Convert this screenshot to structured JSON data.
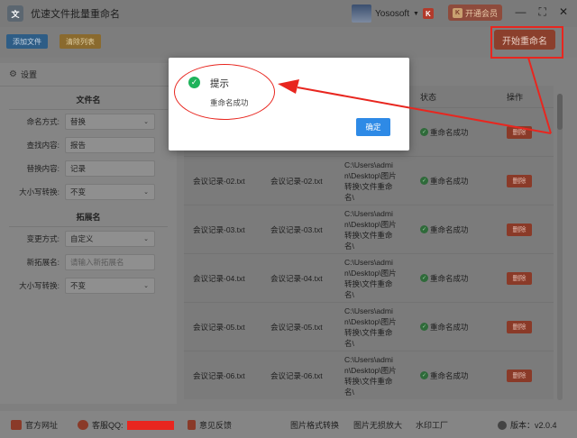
{
  "app": {
    "title": "优速文件批量重命名",
    "user_name": "Yososoft",
    "vip_label": "开通会员",
    "logo_text": "文"
  },
  "toolbar": {
    "add_files": "添加文件",
    "clear_list": "清除列表",
    "start_rename": "开始重命名"
  },
  "settings": {
    "header": "设置",
    "filename_section": "文件名",
    "rename_mode_label": "命名方式:",
    "rename_mode_value": "替换",
    "find_label": "查找内容:",
    "find_value": "报告",
    "replace_label": "替换内容:",
    "replace_value": "记录",
    "case_label": "大小写转换:",
    "case_value": "不变",
    "ext_section": "拓展名",
    "change_mode_label": "变更方式:",
    "change_mode_value": "自定义",
    "new_ext_label": "新拓展名:",
    "new_ext_placeholder": "请输入新拓展名",
    "ext_case_label": "大小写转换:",
    "ext_case_value": "不变"
  },
  "table": {
    "headers": {
      "status": "状态",
      "action": "操作"
    },
    "rows": [
      {
        "new": "",
        "old": "",
        "path": "",
        "status": "重命名成功",
        "action": "删除"
      },
      {
        "new": "会议记录-02.txt",
        "old": "会议记录-02.txt",
        "path": "C:\\Users\\admi\nn\\Desktop\\图片\n转换\\文件重命\n名\\",
        "status": "重命名成功",
        "action": "删除"
      },
      {
        "new": "会议记录-03.txt",
        "old": "会议记录-03.txt",
        "path": "C:\\Users\\admi\nn\\Desktop\\图片\n转换\\文件重命\n名\\",
        "status": "重命名成功",
        "action": "删除"
      },
      {
        "new": "会议记录-04.txt",
        "old": "会议记录-04.txt",
        "path": "C:\\Users\\admi\nn\\Desktop\\图片\n转换\\文件重命\n名\\",
        "status": "重命名成功",
        "action": "删除"
      },
      {
        "new": "会议记录-05.txt",
        "old": "会议记录-05.txt",
        "path": "C:\\Users\\admi\nn\\Desktop\\图片\n转换\\文件重命\n名\\",
        "status": "重命名成功",
        "action": "删除"
      },
      {
        "new": "会议记录-06.txt",
        "old": "会议记录-06.txt",
        "path": "C:\\Users\\admi\nn\\Desktop\\图片\n转换\\文件重命\n名\\",
        "status": "重命名成功",
        "action": "删除"
      }
    ]
  },
  "footer": {
    "website": "官方网址",
    "qq": "客服QQ:",
    "feedback": "意见反馈",
    "img_convert": "图片格式转换",
    "img_enlarge": "图片无损放大",
    "watermark": "水印工厂",
    "version": "版本：v2.0.4"
  },
  "dialog": {
    "title": "提示",
    "message": "重命名成功",
    "ok": "确定"
  },
  "colors": {
    "annotation_red": "#e8261f",
    "success_green": "#1fb35b",
    "ok_blue": "#2e8ae6"
  }
}
